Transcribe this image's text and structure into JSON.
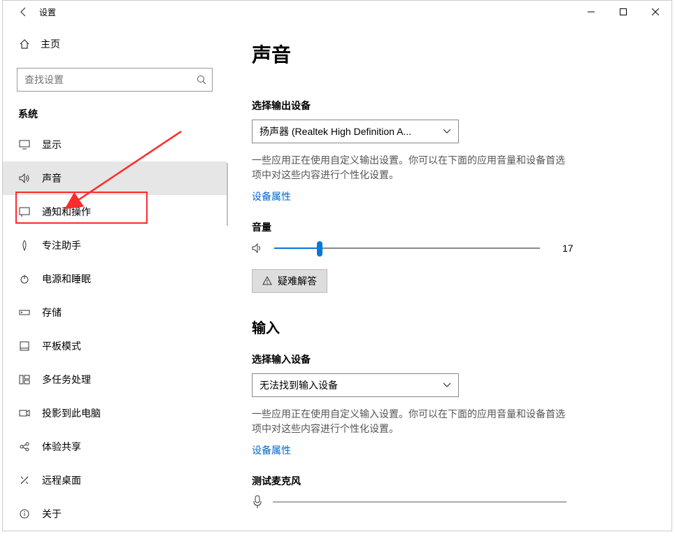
{
  "window": {
    "title": "设置"
  },
  "sidebar": {
    "home": "主页",
    "search_placeholder": "查找设置",
    "section": "系统",
    "items": [
      {
        "label": "显示"
      },
      {
        "label": "声音",
        "selected": true
      },
      {
        "label": "通知和操作"
      },
      {
        "label": "专注助手"
      },
      {
        "label": "电源和睡眠"
      },
      {
        "label": "存储"
      },
      {
        "label": "平板模式"
      },
      {
        "label": "多任务处理"
      },
      {
        "label": "投影到此电脑"
      },
      {
        "label": "体验共享"
      },
      {
        "label": "远程桌面"
      },
      {
        "label": "关于"
      }
    ]
  },
  "main": {
    "title": "声音",
    "output": {
      "select_label": "选择输出设备",
      "selected": "扬声器 (Realtek High Definition A...",
      "help": "一些应用正在使用自定义输出设置。你可以在下面的应用音量和设备首选项中对这些内容进行个性化设置。",
      "props_link": "设备属性",
      "volume_label": "音量",
      "volume_value": "17",
      "troubleshoot": "疑难解答"
    },
    "input_section": {
      "title": "输入",
      "select_label": "选择输入设备",
      "selected": "无法找到输入设备",
      "help": "一些应用正在使用自定义输入设置。你可以在下面的应用音量和设备首选项中对这些内容进行个性化设置。",
      "props_link": "设备属性",
      "test_label": "测试麦克风"
    }
  }
}
